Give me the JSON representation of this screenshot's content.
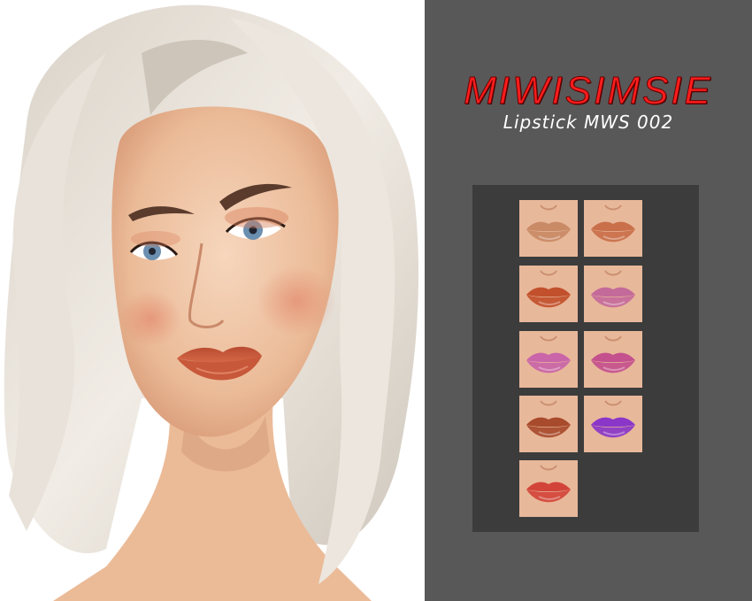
{
  "brand": {
    "name": "MIWISIMSIE",
    "color": "#ff1d1d"
  },
  "product": {
    "title": "Lipstick MWS 002"
  },
  "panel": {
    "background": "#585858",
    "board_background": "#3c3c3c"
  },
  "portrait": {
    "icon": "model-portrait-image",
    "hair_color": "#e6e0d8",
    "skin_color": "#f0c7a8",
    "lip_color": "#c8583a"
  },
  "swatches": [
    {
      "name": "swatch-1",
      "color": "#c98a66"
    },
    {
      "name": "swatch-2",
      "color": "#c96f4a"
    },
    {
      "name": "swatch-3",
      "color": "#c2502c"
    },
    {
      "name": "swatch-4",
      "color": "#c46a9a"
    },
    {
      "name": "swatch-5",
      "color": "#c965a8"
    },
    {
      "name": "swatch-6",
      "color": "#c4508e"
    },
    {
      "name": "swatch-7",
      "color": "#a84a2c"
    },
    {
      "name": "swatch-8",
      "color": "#8a36c8"
    },
    {
      "name": "swatch-9",
      "color": "#d2443a"
    }
  ]
}
